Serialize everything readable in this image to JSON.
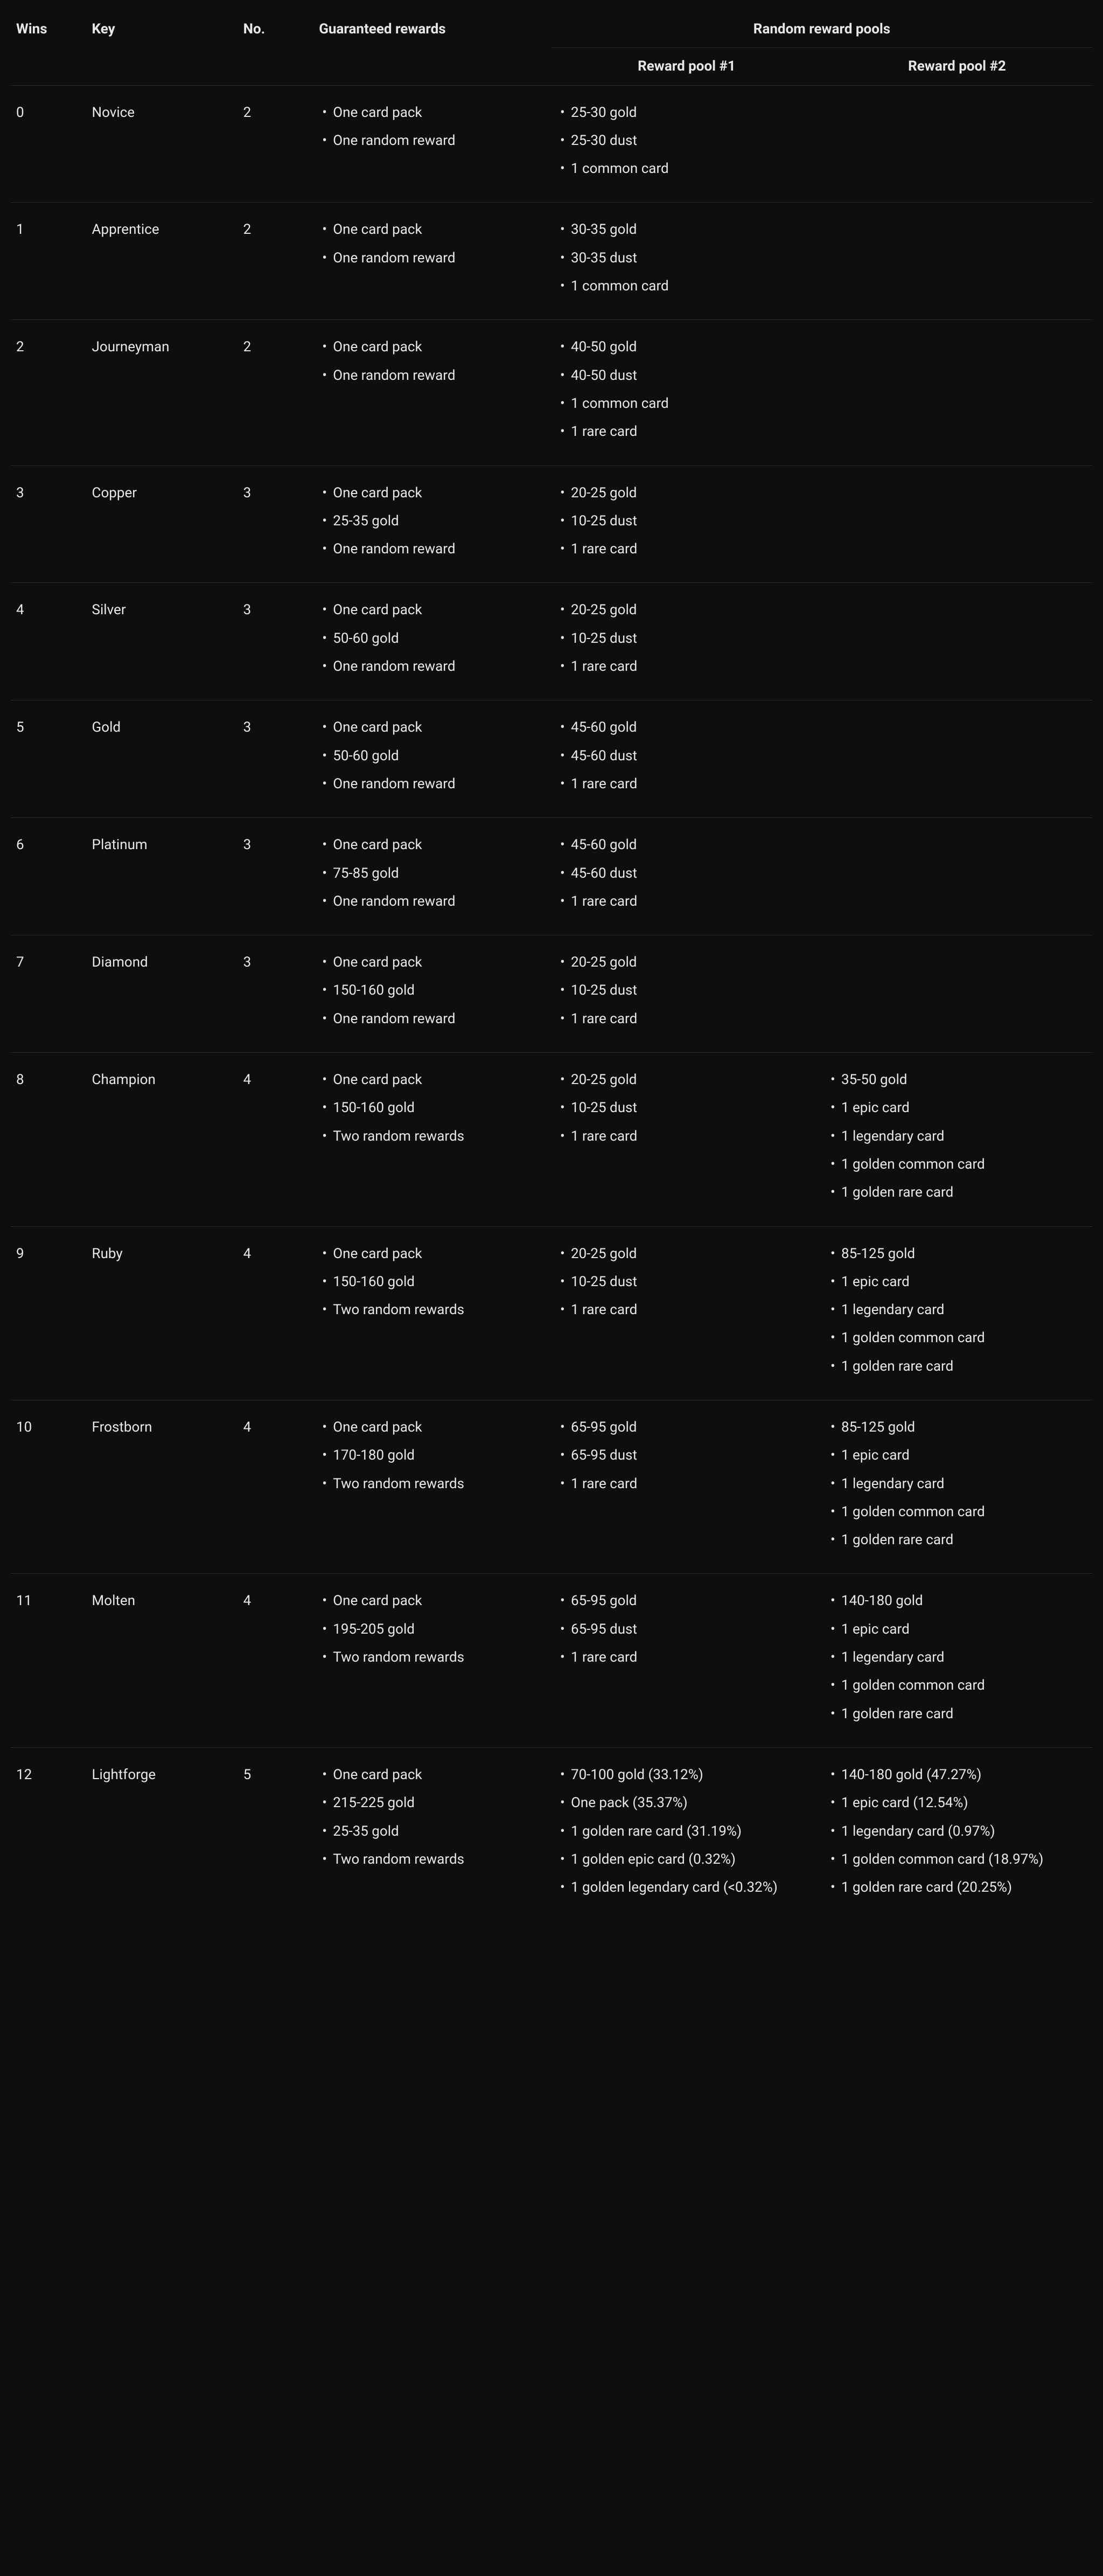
{
  "headers": {
    "wins": "Wins",
    "key": "Key",
    "no": "No.",
    "guaranteed": "Guaranteed rewards",
    "random": "Random reward pools",
    "pool1": "Reward pool #1",
    "pool2": "Reward pool #2"
  },
  "chart_data": {
    "type": "table",
    "title": "Arena reward tiers",
    "columns": [
      "Wins",
      "Key",
      "No.",
      "Guaranteed rewards",
      "Reward pool #1",
      "Reward pool #2"
    ],
    "rows": [
      {
        "wins": "0",
        "key": "Novice",
        "no": "2",
        "guaranteed": [
          "One card pack",
          "One random reward"
        ],
        "pool1": [
          "25-30 gold",
          "25-30 dust",
          "1 common card"
        ],
        "pool2": []
      },
      {
        "wins": "1",
        "key": "Apprentice",
        "no": "2",
        "guaranteed": [
          "One card pack",
          "One random reward"
        ],
        "pool1": [
          "30-35 gold",
          "30-35 dust",
          "1 common card"
        ],
        "pool2": []
      },
      {
        "wins": "2",
        "key": "Journeyman",
        "no": "2",
        "guaranteed": [
          "One card pack",
          "One random reward"
        ],
        "pool1": [
          "40-50 gold",
          "40-50 dust",
          "1 common card",
          "1 rare card"
        ],
        "pool2": []
      },
      {
        "wins": "3",
        "key": "Copper",
        "no": "3",
        "guaranteed": [
          "One card pack",
          "25-35 gold",
          "One random reward"
        ],
        "pool1": [
          "20-25 gold",
          "10-25 dust",
          "1 rare card"
        ],
        "pool2": []
      },
      {
        "wins": "4",
        "key": "Silver",
        "no": "3",
        "guaranteed": [
          "One card pack",
          "50-60 gold",
          "One random reward"
        ],
        "pool1": [
          "20-25 gold",
          "10-25 dust",
          "1 rare card"
        ],
        "pool2": []
      },
      {
        "wins": "5",
        "key": "Gold",
        "no": "3",
        "guaranteed": [
          "One card pack",
          "50-60 gold",
          "One random reward"
        ],
        "pool1": [
          "45-60 gold",
          "45-60 dust",
          "1 rare card"
        ],
        "pool2": []
      },
      {
        "wins": "6",
        "key": "Platinum",
        "no": "3",
        "guaranteed": [
          "One card pack",
          "75-85 gold",
          "One random reward"
        ],
        "pool1": [
          "45-60 gold",
          "45-60 dust",
          "1 rare card"
        ],
        "pool2": []
      },
      {
        "wins": "7",
        "key": "Diamond",
        "no": "3",
        "guaranteed": [
          "One card pack",
          "150-160 gold",
          "One random reward"
        ],
        "pool1": [
          "20-25 gold",
          "10-25 dust",
          "1 rare card"
        ],
        "pool2": []
      },
      {
        "wins": "8",
        "key": "Champion",
        "no": "4",
        "guaranteed": [
          "One card pack",
          "150-160 gold",
          "Two random rewards"
        ],
        "pool1": [
          "20-25 gold",
          "10-25 dust",
          "1 rare card"
        ],
        "pool2": [
          "35-50 gold",
          "1 epic card",
          "1 legendary card",
          "1 golden common card",
          "1 golden rare card"
        ]
      },
      {
        "wins": "9",
        "key": "Ruby",
        "no": "4",
        "guaranteed": [
          "One card pack",
          "150-160 gold",
          "Two random rewards"
        ],
        "pool1": [
          "20-25 gold",
          "10-25 dust",
          "1 rare card"
        ],
        "pool2": [
          "85-125 gold",
          "1 epic card",
          "1 legendary card",
          "1 golden common card",
          "1 golden rare card"
        ]
      },
      {
        "wins": "10",
        "key": "Frostborn",
        "no": "4",
        "guaranteed": [
          "One card pack",
          "170-180 gold",
          "Two random rewards"
        ],
        "pool1": [
          "65-95 gold",
          "65-95 dust",
          "1 rare card"
        ],
        "pool2": [
          "85-125 gold",
          "1 epic card",
          "1 legendary card",
          "1 golden common card",
          "1 golden rare card"
        ]
      },
      {
        "wins": "11",
        "key": "Molten",
        "no": "4",
        "guaranteed": [
          "One card pack",
          "195-205 gold",
          "Two random rewards"
        ],
        "pool1": [
          "65-95 gold",
          "65-95 dust",
          "1 rare card"
        ],
        "pool2": [
          "140-180 gold",
          "1 epic card",
          "1 legendary card",
          "1 golden common card",
          "1 golden rare card"
        ]
      },
      {
        "wins": "12",
        "key": "Lightforge",
        "no": "5",
        "guaranteed": [
          "One card pack",
          "215-225 gold",
          "25-35 gold",
          "Two random rewards"
        ],
        "pool1": [
          "70-100 gold (33.12%)",
          "One pack (35.37%)",
          "1 golden rare card (31.19%)",
          "1 golden epic card (0.32%)",
          "1 golden legendary card (<0.32%)"
        ],
        "pool2": [
          "140-180 gold (47.27%)",
          "1 epic card (12.54%)",
          "1 legendary card (0.97%)",
          "1 golden common card (18.97%)",
          "1 golden rare card (20.25%)"
        ]
      }
    ]
  }
}
